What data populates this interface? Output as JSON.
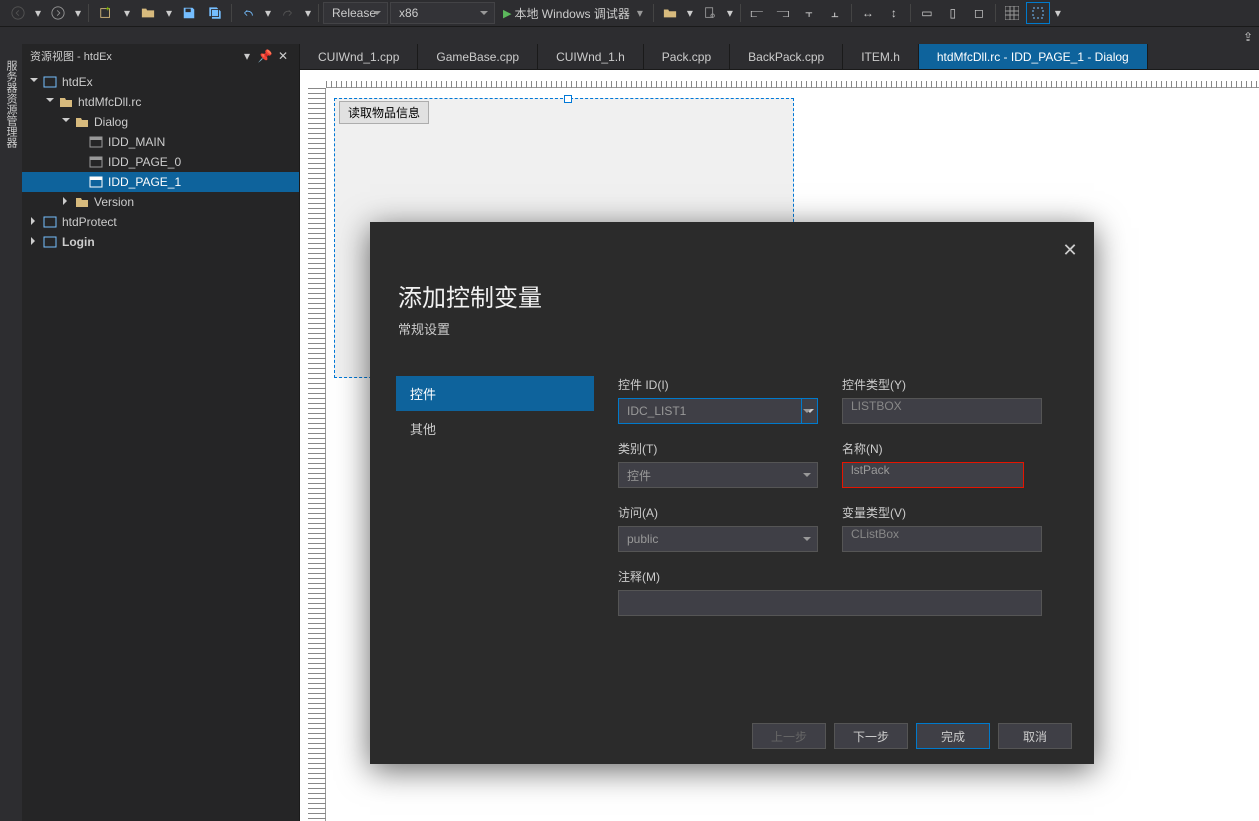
{
  "toolbar": {
    "config": "Release",
    "platform": "x86",
    "debug_label": "本地 Windows 调试器"
  },
  "panel": {
    "title": "资源视图 - htdEx"
  },
  "tree": {
    "root": "htdEx",
    "rc": "htdMfcDll.rc",
    "dialog_folder": "Dialog",
    "dialogs": [
      "IDD_MAIN",
      "IDD_PAGE_0",
      "IDD_PAGE_1"
    ],
    "version_folder": "Version",
    "htdProtect": "htdProtect",
    "login": "Login"
  },
  "tabs": [
    "CUIWnd_1.cpp",
    "GameBase.cpp",
    "CUIWnd_1.h",
    "Pack.cpp",
    "BackPack.cpp",
    "ITEM.h",
    "htdMfcDll.rc - IDD_PAGE_1 - Dialog"
  ],
  "designer": {
    "button_text": "读取物品信息"
  },
  "vtabs": [
    "服务器资源管理器"
  ],
  "modal": {
    "title": "添加控制变量",
    "subtitle": "常规设置",
    "nav": {
      "control": "控件",
      "other": "其他"
    },
    "labels": {
      "control_id": "控件 ID(I)",
      "control_type": "控件类型(Y)",
      "category": "类别(T)",
      "name": "名称(N)",
      "access": "访问(A)",
      "var_type": "变量类型(V)",
      "comment": "注释(M)"
    },
    "values": {
      "control_id": "IDC_LIST1",
      "control_type": "LISTBOX",
      "category": "控件",
      "name": "lstPack",
      "access": "public",
      "var_type": "CListBox",
      "comment": ""
    },
    "buttons": {
      "prev": "上一步",
      "next": "下一步",
      "finish": "完成",
      "cancel": "取消"
    }
  }
}
